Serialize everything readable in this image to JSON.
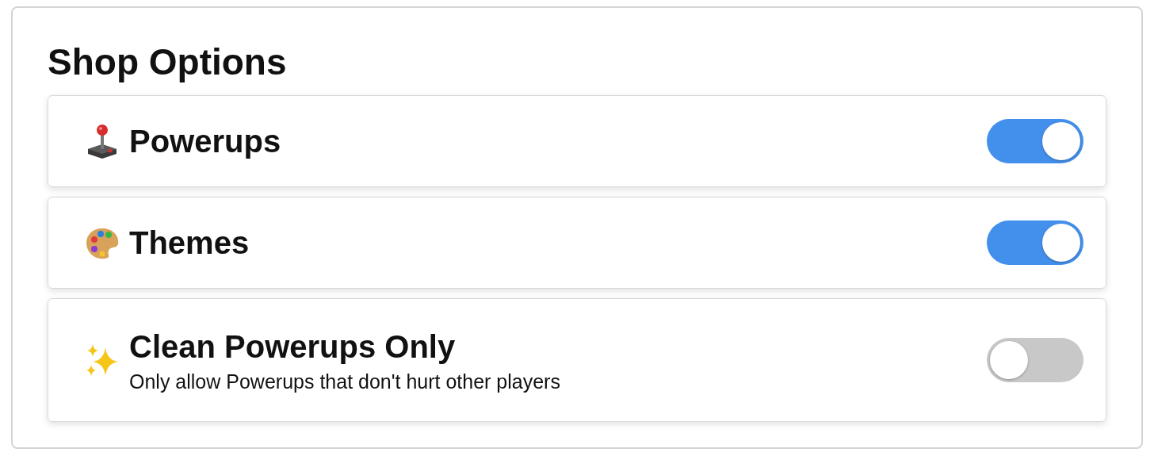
{
  "title": "Shop Options",
  "options": [
    {
      "label": "Powerups",
      "on": true
    },
    {
      "label": "Themes",
      "on": true
    },
    {
      "label": "Clean Powerups Only",
      "description": "Only allow Powerups that don't hurt other players",
      "on": false
    }
  ]
}
